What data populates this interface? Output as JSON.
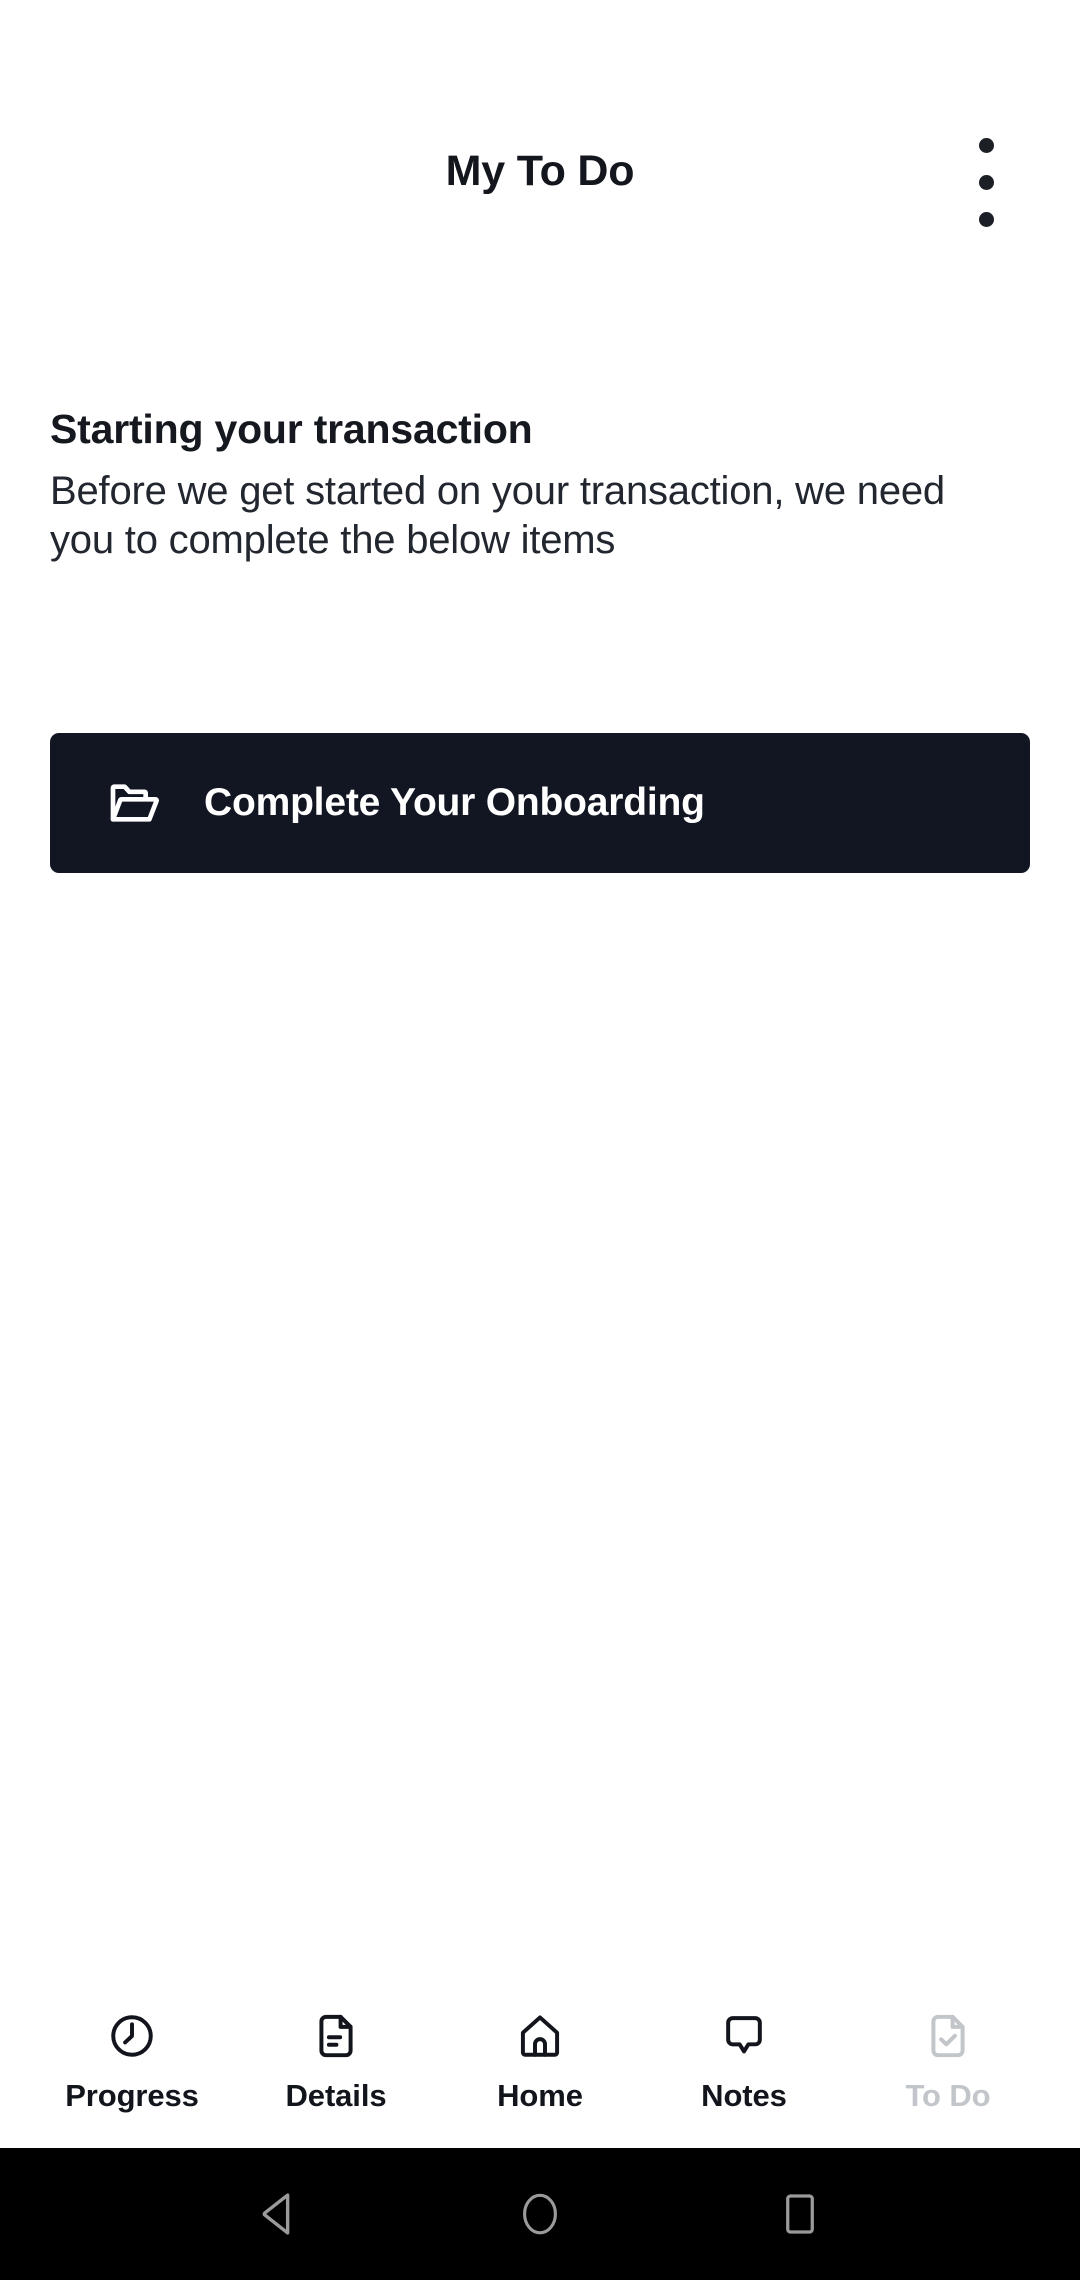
{
  "header": {
    "title": "My To Do",
    "overflow_menu_name": "more-options"
  },
  "content": {
    "heading": "Starting your transaction",
    "body": "Before we get started on your transaction, we need you to complete the below items",
    "action_button": {
      "label": "Complete Your Onboarding",
      "icon": "open-folder-icon",
      "background_color": "#111622",
      "text_color": "#ffffff"
    }
  },
  "tab_bar": {
    "items": [
      {
        "label": "Progress",
        "icon": "clock-icon",
        "active": false
      },
      {
        "label": "Details",
        "icon": "document-lines-icon",
        "active": false
      },
      {
        "label": "Home",
        "icon": "house-icon",
        "active": false
      },
      {
        "label": "Notes",
        "icon": "speech-bubble-icon",
        "active": false
      },
      {
        "label": "To Do",
        "icon": "document-check-icon",
        "active": true
      }
    ],
    "active_color": "#c2c5ca",
    "default_color": "#12151c"
  },
  "system_nav": {
    "back_label": "Back",
    "home_label": "Home",
    "recents_label": "Recent apps",
    "background_color": "#000000",
    "icon_color": "#9a9a9a"
  }
}
